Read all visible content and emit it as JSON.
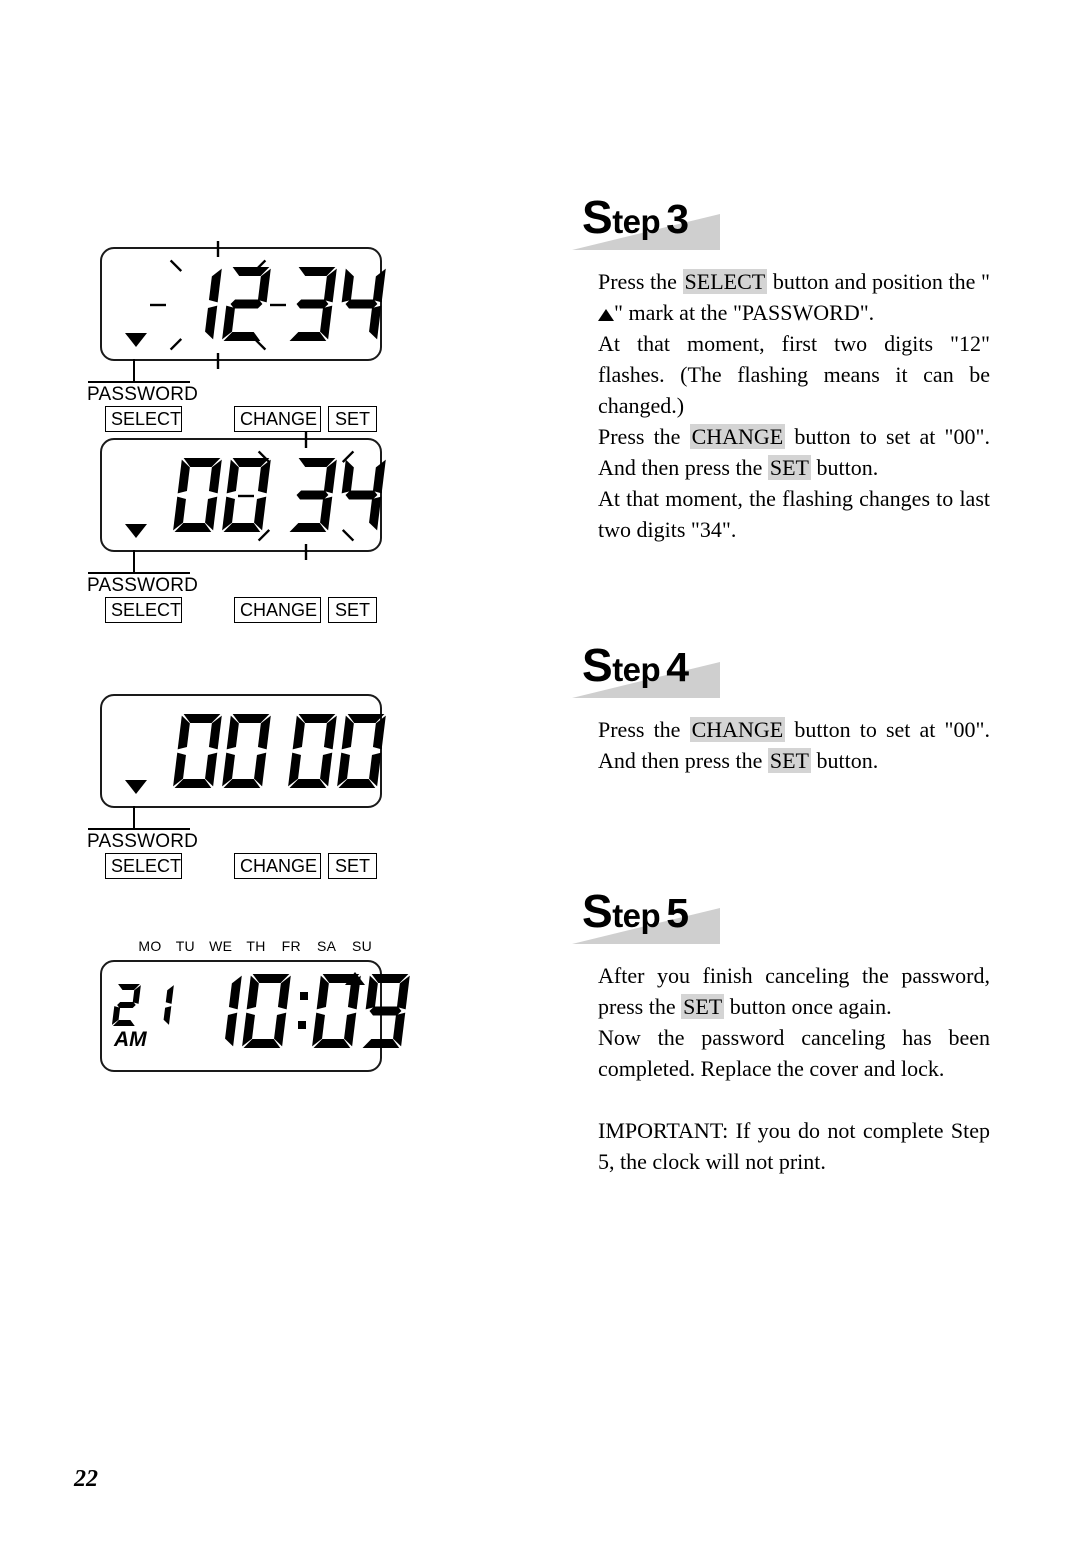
{
  "page": {
    "number": "22"
  },
  "figures": [
    {
      "id": "figure-step3-before",
      "display": "12 34",
      "digits": [
        "1",
        "2",
        "3",
        "4"
      ],
      "flashing_group": "first-two",
      "marker": "down-triangle",
      "marker_label": "PASSWORD",
      "buttons": [
        "SELECT",
        "CHANGE",
        "SET"
      ]
    },
    {
      "id": "figure-step3-after",
      "display": "00 34",
      "digits": [
        "0",
        "0",
        "3",
        "4"
      ],
      "flashing_group": "last-two",
      "marker": "down-triangle",
      "marker_label": "PASSWORD",
      "buttons": [
        "SELECT",
        "CHANGE",
        "SET"
      ]
    },
    {
      "id": "figure-step4-result",
      "display": "00 00",
      "digits": [
        "0",
        "0",
        "0",
        "0"
      ],
      "flashing_group": "none",
      "marker": "down-triangle",
      "marker_label": "PASSWORD",
      "buttons": [
        "SELECT",
        "CHANGE",
        "SET"
      ]
    },
    {
      "id": "figure-step5-normal",
      "day_number": "21",
      "ampm": "AM",
      "time": "10:09",
      "time_digits": [
        "1",
        "0",
        "0",
        "9"
      ],
      "weekdays": [
        "MO",
        "TU",
        "WE",
        "TH",
        "FR",
        "SA",
        "SU"
      ],
      "weekday_marker": "SU",
      "marker": "up-triangle"
    }
  ],
  "steps": [
    {
      "word": "S",
      "word_rest": "tep",
      "number": "3",
      "paragraphs": [
        [
          {
            "t": "Press the "
          },
          {
            "t": "SELECT",
            "hl": true
          },
          {
            "t": " button and position the \""
          },
          {
            "t": "▲",
            "tri": true
          },
          {
            "t": "\" mark at the \"PASSWORD\"."
          }
        ],
        [
          {
            "t": "At that moment, first two digits \"12\" flashes. (The flashing means it can be changed.)"
          }
        ],
        [
          {
            "t": "Press the "
          },
          {
            "t": "CHANGE",
            "hl": true
          },
          {
            "t": " button to set at \"00\". And then press the "
          },
          {
            "t": "SET",
            "hl": true
          },
          {
            "t": " button."
          }
        ],
        [
          {
            "t": "At that moment, the flashing changes to last two digits \"34\"."
          }
        ]
      ]
    },
    {
      "word": "S",
      "word_rest": "tep",
      "number": "4",
      "paragraphs": [
        [
          {
            "t": "Press the "
          },
          {
            "t": "CHANGE",
            "hl": true
          },
          {
            "t": " button to set at \"00\". And then press the "
          },
          {
            "t": "SET",
            "hl": true
          },
          {
            "t": " button."
          }
        ]
      ]
    },
    {
      "word": "S",
      "word_rest": "tep",
      "number": "5",
      "paragraphs": [
        [
          {
            "t": "After you finish canceling the password, press the "
          },
          {
            "t": "SET",
            "hl": true
          },
          {
            "t": " button once again."
          }
        ],
        [
          {
            "t": "Now the password canceling has been completed. Replace the cover and lock."
          }
        ],
        [
          {
            "t": "IMPORTANT: If you do not complete Step 5, the clock will not print."
          }
        ]
      ]
    }
  ]
}
